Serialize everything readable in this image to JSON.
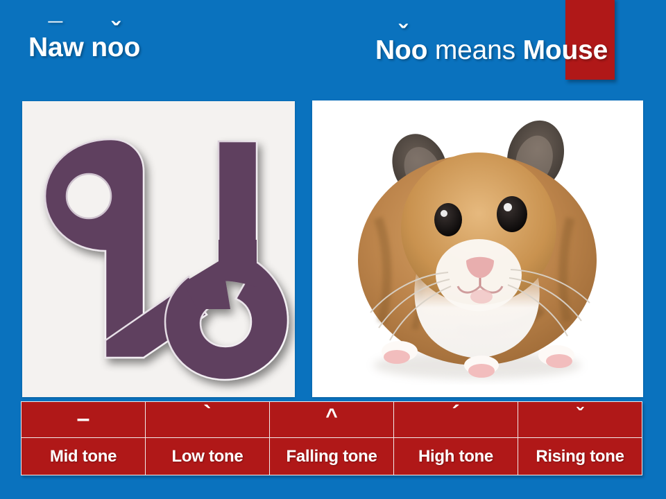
{
  "colors": {
    "background_blue": "#0a72be",
    "accent_red": "#b01818",
    "glyph_purple": "#5f3f5f",
    "panel_offwhite": "#f4f2f0",
    "text_white": "#ffffff"
  },
  "header": {
    "left_title": {
      "full_text": "Nāw nǒo",
      "parts": {
        "n1": "N",
        "a_with_macron": "a",
        "macron": "¯",
        "w": "w",
        "n2": "n",
        "o_with_caron": "o",
        "caron": "ˇ",
        "o2": "o"
      }
    },
    "right_title": {
      "full_text": "Nǒo means Mouse",
      "parts": {
        "n": "N",
        "o_with_caron": "o",
        "caron": "ˇ",
        "o2": "o",
        "means": "means",
        "mouse": "Mouse"
      }
    }
  },
  "panels": {
    "left": {
      "content_name": "thai-letter-noo-nuu",
      "description": "Thai script character",
      "glyph_color": "#5f3f5f",
      "background": "#f4f2f0"
    },
    "right": {
      "content_name": "hamster-photo",
      "description": "Photograph of a brown and white hamster facing the viewer",
      "background": "#ffffff"
    }
  },
  "tone_table": {
    "columns": [
      {
        "mark": "–",
        "mark_name": "macron-mark",
        "label": "Mid tone"
      },
      {
        "mark": "`",
        "mark_name": "grave-mark",
        "label": "Low tone"
      },
      {
        "mark": "^",
        "mark_name": "circumflex-mark",
        "label": "Falling tone"
      },
      {
        "mark": "´",
        "mark_name": "acute-mark",
        "label": "High tone"
      },
      {
        "mark": "ˇ",
        "mark_name": "caron-mark",
        "label": "Rising tone"
      }
    ]
  }
}
